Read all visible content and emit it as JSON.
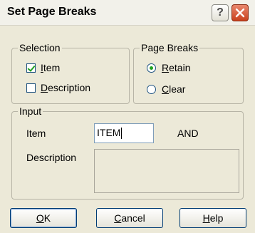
{
  "window": {
    "title": "Set Page Breaks",
    "help_label": "?"
  },
  "selection": {
    "legend": "Selection",
    "item": {
      "prefix": "",
      "accel": "I",
      "rest": "tem",
      "checked": true
    },
    "description": {
      "prefix": "",
      "accel": "D",
      "rest": "escription",
      "checked": false
    }
  },
  "page_breaks": {
    "legend": "Page Breaks",
    "retain": {
      "accel": "R",
      "rest": "etain",
      "selected": true
    },
    "clear": {
      "accel": "C",
      "rest": "lear",
      "selected": false
    }
  },
  "input": {
    "legend": "Input",
    "item_label": "Item",
    "item_value": "ITEM",
    "and_label": "AND",
    "description_label": "Description",
    "description_value": ""
  },
  "buttons": {
    "ok": {
      "accel": "O",
      "rest": "K"
    },
    "cancel": {
      "accel": "C",
      "rest": "ancel"
    },
    "help": {
      "accel": "H",
      "rest": "elp"
    }
  }
}
